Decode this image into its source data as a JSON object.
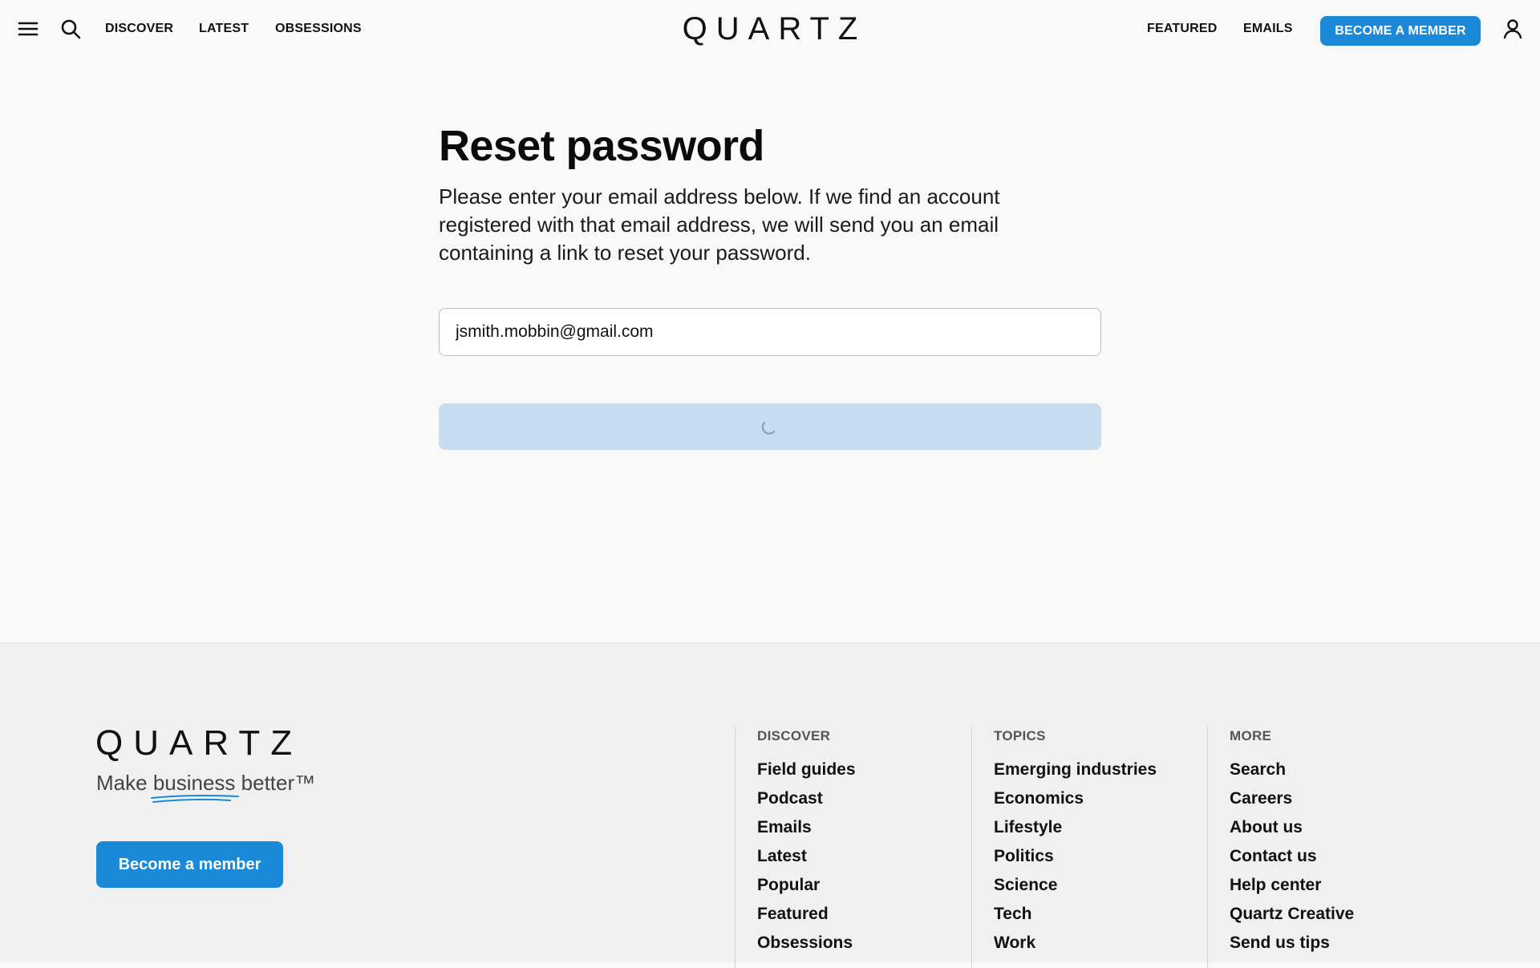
{
  "header": {
    "nav_left": [
      "DISCOVER",
      "LATEST",
      "OBSESSIONS"
    ],
    "logo": "QUARTZ",
    "nav_right": [
      "FEATURED",
      "EMAILS"
    ],
    "member_button": "BECOME A MEMBER",
    "icons": {
      "menu": "hamburger-menu-icon",
      "search": "search-icon",
      "account": "user-account-icon"
    }
  },
  "main": {
    "title": "Reset password",
    "description": "Please enter your email address below. If we find an account registered with that email address, we will send you an email containing a link to reset your password.",
    "email_value": "jsmith.mobbin@gmail.com",
    "submit_state": "loading"
  },
  "footer": {
    "logo": "QUARTZ",
    "tagline": {
      "before": "Make ",
      "underlined": "business",
      "after": " better™"
    },
    "member_button": "Become a member",
    "columns": [
      {
        "heading": "DISCOVER",
        "items": [
          "Field guides",
          "Podcast",
          "Emails",
          "Latest",
          "Popular",
          "Featured",
          "Obsessions"
        ]
      },
      {
        "heading": "TOPICS",
        "items": [
          "Emerging industries",
          "Economics",
          "Lifestyle",
          "Politics",
          "Science",
          "Tech",
          "Work"
        ]
      },
      {
        "heading": "MORE",
        "items": [
          "Search",
          "Careers",
          "About us",
          "Contact us",
          "Help center",
          "Quartz Creative",
          "Send us tips"
        ]
      }
    ]
  },
  "colors": {
    "brand_blue": "#1a8ad8",
    "disabled_button": "#c8ddf0",
    "page_bg": "#f9f9f9",
    "footer_bg": "#f0f0f0"
  }
}
